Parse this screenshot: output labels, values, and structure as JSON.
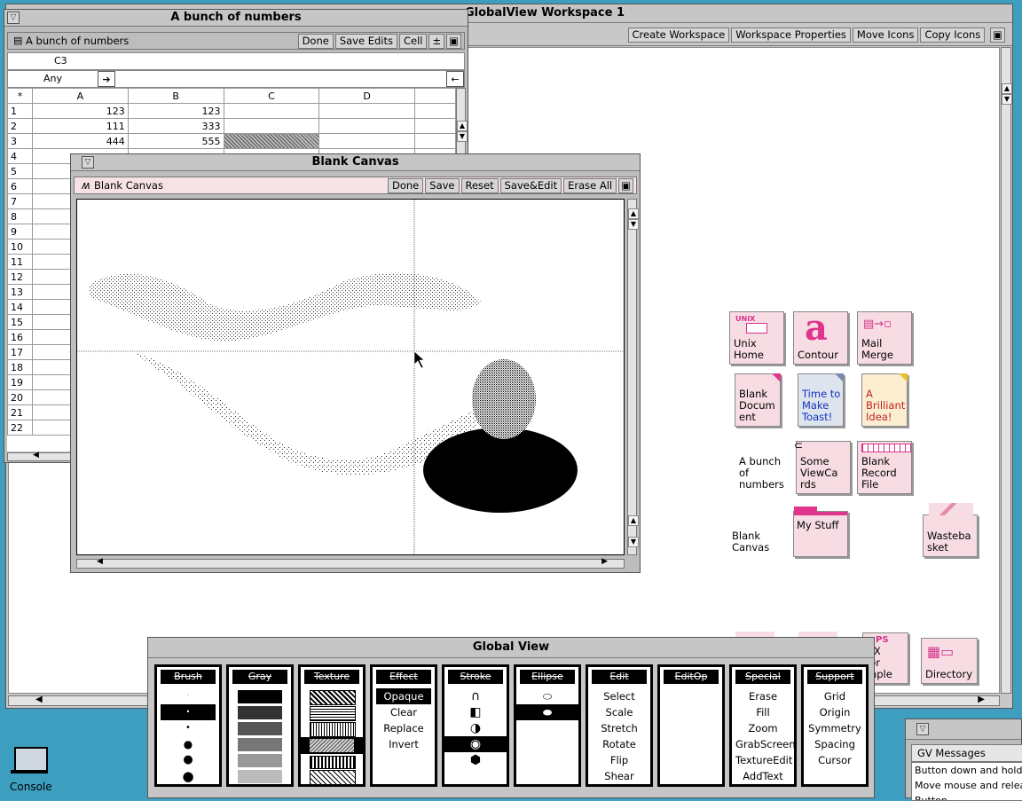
{
  "workspace": {
    "title": "GlobalView Workspace 1",
    "buttons": [
      "Create Workspace",
      "Workspace Properties",
      "Move Icons",
      "Copy Icons"
    ]
  },
  "spreadsheet": {
    "title": "A bunch of numbers",
    "doc_name": "A bunch of numbers",
    "buttons": [
      "Done",
      "Save Edits",
      "Cell"
    ],
    "cell_ref": "C3",
    "filter": "Any",
    "columns": [
      "*",
      "A",
      "B",
      "C",
      "D"
    ],
    "rows": [
      {
        "n": "1",
        "a": "123",
        "b": "123"
      },
      {
        "n": "2",
        "a": "111",
        "b": "333"
      },
      {
        "n": "3",
        "a": "444",
        "b": "555"
      },
      {
        "n": "4",
        "a": "",
        "b": ""
      },
      {
        "n": "5",
        "a": "",
        "b": ""
      },
      {
        "n": "6",
        "a": "",
        "b": ""
      },
      {
        "n": "7",
        "a": "",
        "b": ""
      },
      {
        "n": "8",
        "a": "",
        "b": ""
      },
      {
        "n": "9",
        "a": "",
        "b": ""
      },
      {
        "n": "10",
        "a": "",
        "b": ""
      },
      {
        "n": "11",
        "a": "",
        "b": ""
      },
      {
        "n": "12",
        "a": "",
        "b": ""
      },
      {
        "n": "13",
        "a": "",
        "b": ""
      },
      {
        "n": "14",
        "a": "",
        "b": ""
      },
      {
        "n": "15",
        "a": "",
        "b": ""
      },
      {
        "n": "16",
        "a": "",
        "b": ""
      },
      {
        "n": "17",
        "a": "",
        "b": ""
      },
      {
        "n": "18",
        "a": "",
        "b": ""
      },
      {
        "n": "19",
        "a": "",
        "b": ""
      },
      {
        "n": "20",
        "a": "",
        "b": ""
      },
      {
        "n": "21",
        "a": "",
        "b": ""
      },
      {
        "n": "22",
        "a": "",
        "b": ""
      }
    ]
  },
  "canvas": {
    "title": "Blank Canvas",
    "doc_name": "Blank Canvas",
    "buttons": [
      "Done",
      "Save",
      "Reset",
      "Save&Edit",
      "Erase All"
    ]
  },
  "icons": [
    {
      "name": "icon-unix-home",
      "badge": "UNIX",
      "label": "Unix\nHome"
    },
    {
      "name": "icon-contour",
      "glyph": "a",
      "label": "Contour"
    },
    {
      "name": "icon-mail-merge",
      "label": "Mail\nMerge"
    },
    {
      "name": "icon-blank-document",
      "label": "Blank\nDocum\nent"
    },
    {
      "name": "icon-time-to-make-toast",
      "label": "Time to\nMake\nToast!"
    },
    {
      "name": "icon-a-brilliant-idea",
      "label": "A\nBrilliant\nIdea!"
    },
    {
      "name": "icon-a-bunch-of-numbers",
      "label": "A bunch\nof\nnumbers"
    },
    {
      "name": "icon-some-viewcards",
      "label": "Some\nViewCa\nrds"
    },
    {
      "name": "icon-blank-record-file",
      "label": "Blank\nRecord\nFile"
    },
    {
      "name": "icon-blank-canvas",
      "label": "Blank\nCanvas"
    },
    {
      "name": "icon-my-stuff",
      "label": "My Stuff"
    },
    {
      "name": "icon-wastebasket",
      "label": "Wasteba\nsket"
    },
    {
      "name": "icon-ps-color-sample",
      "badge": "PS",
      "label": "VX\nlor\nmple"
    },
    {
      "name": "icon-directory",
      "label": "Directory"
    }
  ],
  "global_view": {
    "title": "Global View",
    "panels": [
      {
        "title": "Brush",
        "items": []
      },
      {
        "title": "Gray",
        "items": []
      },
      {
        "title": "Texture",
        "items": []
      },
      {
        "title": "Effect",
        "items": [
          "Opaque",
          "Clear",
          "Replace",
          "Invert"
        ],
        "selected": 0
      },
      {
        "title": "Stroke",
        "items": []
      },
      {
        "title": "Ellipse",
        "items": []
      },
      {
        "title": "Edit",
        "items": [
          "Select",
          "Scale",
          "Stretch",
          "Rotate",
          "Flip",
          "Shear"
        ]
      },
      {
        "title": "EditOp",
        "items": []
      },
      {
        "title": "Special",
        "items": [
          "Erase",
          "Fill",
          "Zoom",
          "GrabScreen",
          "TextureEdit",
          "AddText"
        ]
      },
      {
        "title": "Support",
        "items": [
          "Grid",
          "Origin",
          "Symmetry",
          "Spacing",
          "Cursor"
        ]
      }
    ]
  },
  "console": {
    "label": "Console"
  },
  "messages": {
    "title": "GV Messages",
    "lines": [
      "Button down and hold",
      "Move mouse and relea",
      "Button"
    ]
  }
}
